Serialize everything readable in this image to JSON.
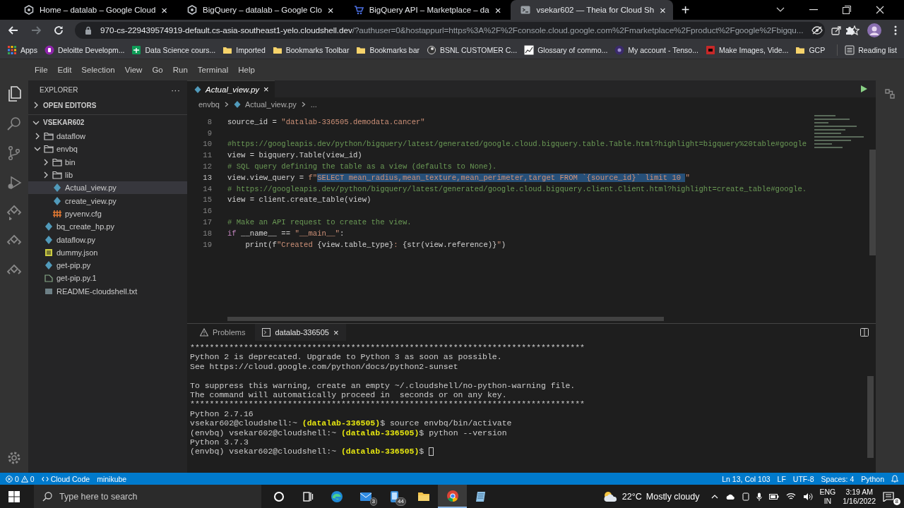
{
  "browser": {
    "tabs": [
      {
        "title": "Home – datalab – Google Cloud",
        "kind": "hex",
        "selected": false,
        "close": "×"
      },
      {
        "title": "BigQuery – datalab – Google Clo",
        "kind": "hex",
        "selected": false,
        "close": "×"
      },
      {
        "title": "BigQuery API – Marketplace – da",
        "kind": "cart",
        "selected": false,
        "close": "×"
      },
      {
        "title": "vsekar602 — Theia for Cloud Sh",
        "kind": "terminal",
        "selected": true,
        "close": "×"
      }
    ],
    "new_tab": "+",
    "address": {
      "host": "970-cs-229439574919-default.cs-asia-southeast1-yelo.cloudshell.dev",
      "rest": "/?authuser=0&hostappurl=https%3A%2F%2Fconsole.cloud.google.com%2Fmarketplace%2Fproduct%2Fgoogle%2Fbigqu..."
    },
    "bookmarks": [
      {
        "label": "Apps",
        "kind": "apps"
      },
      {
        "label": "Deloitte Developm...",
        "kind": "purple"
      },
      {
        "label": "Data Science cours...",
        "kind": "sheet"
      },
      {
        "label": "Imported",
        "kind": "folder"
      },
      {
        "label": "Bookmarks Toolbar",
        "kind": "folder"
      },
      {
        "label": "Bookmarks bar",
        "kind": "folder"
      },
      {
        "label": "BSNL CUSTOMER C...",
        "kind": "site"
      },
      {
        "label": "Glossary of commo...",
        "kind": "chart"
      },
      {
        "label": "My account - Tenso...",
        "kind": "dark"
      },
      {
        "label": "Make Images, Vide...",
        "kind": "red"
      },
      {
        "label": "GCP",
        "kind": "folder"
      }
    ],
    "reading_list": "Reading list"
  },
  "menu": [
    "File",
    "Edit",
    "Selection",
    "View",
    "Go",
    "Run",
    "Terminal",
    "Help"
  ],
  "explorer": {
    "title": "EXPLORER",
    "more": "···",
    "open_editors": {
      "label": "OPEN EDITORS",
      "expanded": false
    },
    "root": {
      "label": "VSEKAR602",
      "expanded": true,
      "children": [
        {
          "label": "dataflow",
          "kind": "folder",
          "expanded": false,
          "selected": false
        },
        {
          "label": "envbq",
          "kind": "folder",
          "expanded": true,
          "selected": false,
          "children": [
            {
              "label": "bin",
              "kind": "folder",
              "expanded": false,
              "selected": false
            },
            {
              "label": "lib",
              "kind": "folder",
              "expanded": false,
              "selected": false
            },
            {
              "label": "Actual_view.py",
              "kind": "python",
              "selected": true
            },
            {
              "label": "create_view.py",
              "kind": "python",
              "selected": false
            },
            {
              "label": "pyvenv.cfg",
              "kind": "config",
              "selected": false
            }
          ]
        },
        {
          "label": "bq_create_hp.py",
          "kind": "python",
          "selected": false
        },
        {
          "label": "dataflow.py",
          "kind": "python",
          "selected": false
        },
        {
          "label": "dummy.json",
          "kind": "json",
          "selected": false
        },
        {
          "label": "get-pip.py",
          "kind": "python",
          "selected": false
        },
        {
          "label": "get-pip.py.1",
          "kind": "file",
          "selected": false
        },
        {
          "label": "README-cloudshell.txt",
          "kind": "text",
          "selected": false
        }
      ]
    }
  },
  "editor": {
    "tab": {
      "label": "Actual_view.py",
      "close": "×"
    },
    "breadcrumb": [
      "envbq",
      "Actual_view.py",
      "..."
    ],
    "lines": [
      {
        "number": "8",
        "current": false,
        "tokens": [
          {
            "kind": "plain",
            "text": "source_id = "
          },
          {
            "kind": "string",
            "text": "\"datalab-336505.demodata.cancer\""
          }
        ]
      },
      {
        "number": "9",
        "current": false
      },
      {
        "number": "10",
        "current": false,
        "tokens": [
          {
            "kind": "comment",
            "text": "#https://googleapis.dev/python/bigquery/latest/generated/google.cloud.bigquery.table.Table.html?highlight=bigquery%20table#google"
          }
        ]
      },
      {
        "number": "11",
        "current": false,
        "tokens": [
          {
            "kind": "plain",
            "text": "view = bigquery.Table(view_id)"
          }
        ]
      },
      {
        "number": "12",
        "current": false,
        "tokens": [
          {
            "kind": "comment",
            "text": "# SQL query defining the table as a view (defaults to None)."
          }
        ]
      },
      {
        "number": "13",
        "current": true,
        "tokens": [
          {
            "kind": "plain",
            "text": "view.view_query = "
          },
          {
            "kind": "string",
            "text": "f\""
          },
          {
            "kind": "selected",
            "text": "SELECT mean_radius,mean_texture,mean_perimeter,target FROM `{source_id}` limit 10 "
          },
          {
            "kind": "string",
            "text": "\""
          }
        ]
      },
      {
        "number": "14",
        "current": false,
        "tokens": [
          {
            "kind": "comment",
            "text": "# https://googleapis.dev/python/bigquery/latest/generated/google.cloud.bigquery.client.Client.html?highlight=create_table#google."
          }
        ]
      },
      {
        "number": "15",
        "current": false,
        "tokens": [
          {
            "kind": "plain",
            "text": "view = client.create_table(view)"
          }
        ]
      },
      {
        "number": "16",
        "current": false
      },
      {
        "number": "17",
        "current": false,
        "tokens": [
          {
            "kind": "comment",
            "text": "# Make an API request to create the view."
          }
        ]
      },
      {
        "number": "18",
        "current": false,
        "tokens": [
          {
            "kind": "keyword",
            "text": "if"
          },
          {
            "kind": "plain",
            "text": " __name__ == "
          },
          {
            "kind": "string",
            "text": "\"__main__\""
          },
          {
            "kind": "plain",
            "text": ":"
          }
        ]
      },
      {
        "number": "19",
        "current": false,
        "tokens": [
          {
            "kind": "plain",
            "text": "    print(f"
          },
          {
            "kind": "string",
            "text": "\"Created "
          },
          {
            "kind": "plain",
            "text": "{view.table_type}"
          },
          {
            "kind": "string",
            "text": ": "
          },
          {
            "kind": "plain",
            "text": "{str(view.reference)}"
          },
          {
            "kind": "string",
            "text": "\""
          },
          {
            "kind": "plain",
            "text": ")"
          }
        ]
      }
    ]
  },
  "panel": {
    "tabs": [
      {
        "label": "Problems",
        "kind": "problems",
        "selected": false
      },
      {
        "label": "datalab-336505",
        "kind": "terminal",
        "selected": true,
        "close": "×"
      }
    ],
    "terminal": [
      [
        {
          "kind": "plain",
          "text": "*********************************************************************************"
        }
      ],
      [
        {
          "kind": "plain",
          "text": "Python 2 is deprecated. Upgrade to Python 3 as soon as possible."
        }
      ],
      [
        {
          "kind": "plain",
          "text": "See https://cloud.google.com/python/docs/python2-sunset"
        }
      ],
      [
        {
          "kind": "blank"
        }
      ],
      [
        {
          "kind": "plain",
          "text": "To suppress this warning, create an empty ~/.cloudshell/no-python-warning file."
        }
      ],
      [
        {
          "kind": "plain",
          "text": "The command will automatically proceed in  seconds or on any key."
        }
      ],
      [
        {
          "kind": "plain",
          "text": "*********************************************************************************"
        }
      ],
      [
        {
          "kind": "plain",
          "text": "Python 2.7.16"
        }
      ],
      [
        {
          "kind": "plain",
          "text": "vsekar602@cloudshell:~ "
        },
        {
          "kind": "project",
          "text": "(datalab-336505)"
        },
        {
          "kind": "plain",
          "text": "$ source envbq/bin/activate"
        }
      ],
      [
        {
          "kind": "plain",
          "text": "(envbq) vsekar602@cloudshell:~ "
        },
        {
          "kind": "project",
          "text": "(datalab-336505)"
        },
        {
          "kind": "plain",
          "text": "$ python --version"
        }
      ],
      [
        {
          "kind": "plain",
          "text": "Python 3.7.3"
        }
      ],
      [
        {
          "kind": "plain",
          "text": "(envbq) vsekar602@cloudshell:~ "
        },
        {
          "kind": "project",
          "text": "(datalab-336505)"
        },
        {
          "kind": "plain",
          "text": "$ "
        },
        {
          "kind": "cursor"
        }
      ]
    ]
  },
  "status_bar": {
    "errors": "0",
    "warnings": "0",
    "left": [
      {
        "label": "Cloud Code",
        "kind": "code"
      },
      {
        "label": "minikube",
        "kind": "plain"
      }
    ],
    "right": [
      "Ln 13, Col 103",
      "LF",
      "UTF-8",
      "Spaces: 4",
      "Python"
    ]
  },
  "taskbar": {
    "search": {
      "placeholder": "Type here to search"
    },
    "apps": [
      {
        "kind": "cortana",
        "active": false
      },
      {
        "kind": "taskview",
        "active": false
      },
      {
        "kind": "edge",
        "active": false
      },
      {
        "kind": "mail",
        "badge": "3",
        "active": false
      },
      {
        "kind": "phone",
        "badge": "44",
        "active": false
      },
      {
        "kind": "folder",
        "active": false
      },
      {
        "kind": "chrome",
        "active": true
      },
      {
        "kind": "notes",
        "active": false
      }
    ],
    "weather": {
      "temp": "22°C",
      "text": "Mostly cloudy"
    },
    "lang": [
      "ENG",
      "IN"
    ],
    "time": "3:19 AM",
    "date": "1/16/2022",
    "notifications": "8"
  }
}
